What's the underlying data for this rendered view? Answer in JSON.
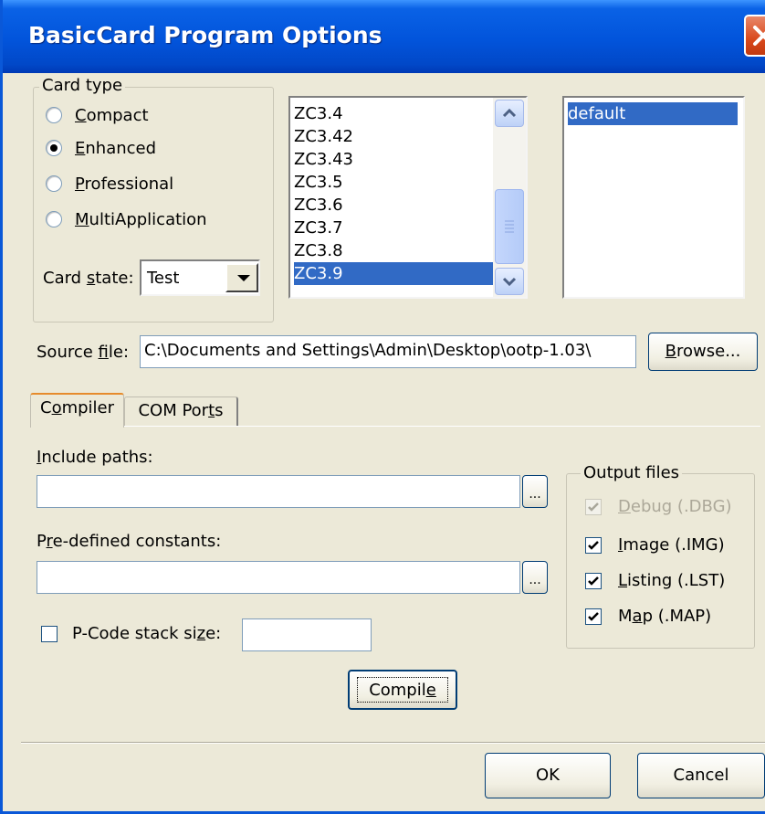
{
  "window": {
    "title": "BasicCard Program Options"
  },
  "card_type": {
    "label": "Card type",
    "options": [
      {
        "pre": "",
        "u": "C",
        "post": "ompact",
        "selected": false
      },
      {
        "pre": "",
        "u": "E",
        "post": "nhanced",
        "selected": true
      },
      {
        "pre": "",
        "u": "P",
        "post": "rofessional",
        "selected": false
      },
      {
        "pre": "",
        "u": "M",
        "post": "ultiApplication",
        "selected": false
      }
    ]
  },
  "card_state": {
    "label_pre": "Card ",
    "label_u": "s",
    "label_post": "tate:",
    "value": "Test"
  },
  "version_list": {
    "items": [
      "ZC3.4",
      "ZC3.42",
      "ZC3.43",
      "ZC3.5",
      "ZC3.6",
      "ZC3.7",
      "ZC3.8",
      "ZC3.9"
    ],
    "selected": "ZC3.9"
  },
  "config_list": {
    "items": [
      "default"
    ],
    "selected": "default"
  },
  "source_file": {
    "label_pre": "Source ",
    "label_u": "f",
    "label_post": "ile:",
    "value": "C:\\Documents and Settings\\Admin\\Desktop\\ootp-1.03\\",
    "browse_pre": "",
    "browse_u": "B",
    "browse_post": "rowse..."
  },
  "tabs": [
    {
      "pre": "C",
      "u": "o",
      "post": "mpiler",
      "active": true
    },
    {
      "pre": "COM Por",
      "u": "t",
      "post": "s",
      "active": false
    }
  ],
  "compiler": {
    "include_label_pre": "",
    "include_label_u": "I",
    "include_label_post": "nclude paths:",
    "include_value": "",
    "constants_label_pre": "P",
    "constants_label_u": "r",
    "constants_label_post": "e-defined constants:",
    "constants_value": "",
    "ellipsis": "...",
    "pcode_pre": "P-Code stack si",
    "pcode_u": "z",
    "pcode_post": "e:",
    "pcode_checked": false,
    "pcode_value": "",
    "compile_pre": "Compil",
    "compile_u": "e",
    "compile_post": ""
  },
  "output_files": {
    "label": "Output files",
    "items": [
      {
        "pre": "",
        "u": "D",
        "post": "ebug (.DBG)",
        "checked": true,
        "disabled": true
      },
      {
        "pre": "",
        "u": "I",
        "post": "mage (.IMG)",
        "checked": true,
        "disabled": false
      },
      {
        "pre": "",
        "u": "L",
        "post": "isting (.LST)",
        "checked": true,
        "disabled": false
      },
      {
        "pre": "M",
        "u": "a",
        "post": "p (.MAP)",
        "checked": true,
        "disabled": false
      }
    ]
  },
  "buttons": {
    "ok": "OK",
    "cancel": "Cancel"
  },
  "colors": {
    "titlebar": "#0254db",
    "face": "#ece9d8",
    "selection": "#316ac5"
  }
}
